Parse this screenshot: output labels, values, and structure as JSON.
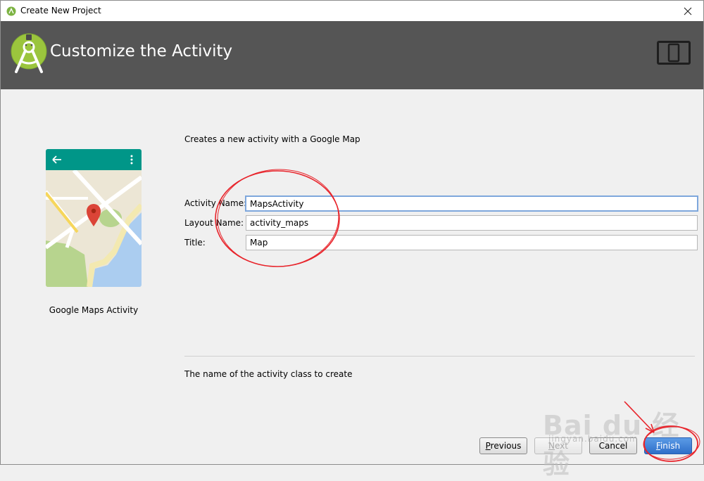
{
  "window": {
    "title": "Create New Project"
  },
  "banner": {
    "title": "Customize the Activity"
  },
  "preview": {
    "label": "Google Maps Activity"
  },
  "main": {
    "description": "Creates a new activity with a Google Map",
    "fields": [
      {
        "label": "Activity Name:",
        "value": "MapsActivity"
      },
      {
        "label": "Layout Name:",
        "value": "activity_maps"
      },
      {
        "label": "Title:",
        "value": "Map"
      }
    ],
    "help_text": "The name of the activity class to create"
  },
  "buttons": {
    "previous": "Previous",
    "next": "Next",
    "cancel": "Cancel",
    "finish": "Finish"
  },
  "watermark": {
    "brand": "Bai du 经验",
    "url": "jingyan.baidu.com"
  },
  "colors": {
    "banner_bg": "#555555",
    "android_green": "#9bc53d",
    "map_toolbar": "#009688",
    "annotation_red": "#e8242b",
    "primary_button": "#3b7ed6"
  }
}
